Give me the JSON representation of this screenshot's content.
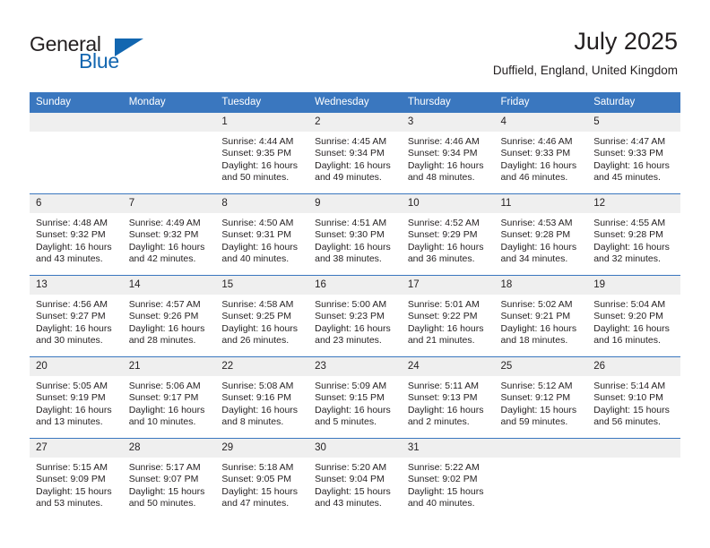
{
  "brand": {
    "name_part1": "General",
    "name_part2": "Blue",
    "flag_icon": "blue-triangle-flag"
  },
  "header": {
    "title": "July 2025",
    "location": "Duffield, England, United Kingdom"
  },
  "colors": {
    "header_blue": "#3a77bf",
    "daynum_bg": "#efefef",
    "brand_blue": "#1266b0",
    "text": "#231f20"
  },
  "weekday_headers": [
    "Sunday",
    "Monday",
    "Tuesday",
    "Wednesday",
    "Thursday",
    "Friday",
    "Saturday"
  ],
  "weeks": [
    [
      {
        "day": "",
        "empty": true,
        "sunrise": "",
        "sunset": "",
        "daylight1": "",
        "daylight2": ""
      },
      {
        "day": "",
        "empty": true,
        "sunrise": "",
        "sunset": "",
        "daylight1": "",
        "daylight2": ""
      },
      {
        "day": "1",
        "sunrise": "Sunrise: 4:44 AM",
        "sunset": "Sunset: 9:35 PM",
        "daylight1": "Daylight: 16 hours",
        "daylight2": "and 50 minutes."
      },
      {
        "day": "2",
        "sunrise": "Sunrise: 4:45 AM",
        "sunset": "Sunset: 9:34 PM",
        "daylight1": "Daylight: 16 hours",
        "daylight2": "and 49 minutes."
      },
      {
        "day": "3",
        "sunrise": "Sunrise: 4:46 AM",
        "sunset": "Sunset: 9:34 PM",
        "daylight1": "Daylight: 16 hours",
        "daylight2": "and 48 minutes."
      },
      {
        "day": "4",
        "sunrise": "Sunrise: 4:46 AM",
        "sunset": "Sunset: 9:33 PM",
        "daylight1": "Daylight: 16 hours",
        "daylight2": "and 46 minutes."
      },
      {
        "day": "5",
        "sunrise": "Sunrise: 4:47 AM",
        "sunset": "Sunset: 9:33 PM",
        "daylight1": "Daylight: 16 hours",
        "daylight2": "and 45 minutes."
      }
    ],
    [
      {
        "day": "6",
        "sunrise": "Sunrise: 4:48 AM",
        "sunset": "Sunset: 9:32 PM",
        "daylight1": "Daylight: 16 hours",
        "daylight2": "and 43 minutes."
      },
      {
        "day": "7",
        "sunrise": "Sunrise: 4:49 AM",
        "sunset": "Sunset: 9:32 PM",
        "daylight1": "Daylight: 16 hours",
        "daylight2": "and 42 minutes."
      },
      {
        "day": "8",
        "sunrise": "Sunrise: 4:50 AM",
        "sunset": "Sunset: 9:31 PM",
        "daylight1": "Daylight: 16 hours",
        "daylight2": "and 40 minutes."
      },
      {
        "day": "9",
        "sunrise": "Sunrise: 4:51 AM",
        "sunset": "Sunset: 9:30 PM",
        "daylight1": "Daylight: 16 hours",
        "daylight2": "and 38 minutes."
      },
      {
        "day": "10",
        "sunrise": "Sunrise: 4:52 AM",
        "sunset": "Sunset: 9:29 PM",
        "daylight1": "Daylight: 16 hours",
        "daylight2": "and 36 minutes."
      },
      {
        "day": "11",
        "sunrise": "Sunrise: 4:53 AM",
        "sunset": "Sunset: 9:28 PM",
        "daylight1": "Daylight: 16 hours",
        "daylight2": "and 34 minutes."
      },
      {
        "day": "12",
        "sunrise": "Sunrise: 4:55 AM",
        "sunset": "Sunset: 9:28 PM",
        "daylight1": "Daylight: 16 hours",
        "daylight2": "and 32 minutes."
      }
    ],
    [
      {
        "day": "13",
        "sunrise": "Sunrise: 4:56 AM",
        "sunset": "Sunset: 9:27 PM",
        "daylight1": "Daylight: 16 hours",
        "daylight2": "and 30 minutes."
      },
      {
        "day": "14",
        "sunrise": "Sunrise: 4:57 AM",
        "sunset": "Sunset: 9:26 PM",
        "daylight1": "Daylight: 16 hours",
        "daylight2": "and 28 minutes."
      },
      {
        "day": "15",
        "sunrise": "Sunrise: 4:58 AM",
        "sunset": "Sunset: 9:25 PM",
        "daylight1": "Daylight: 16 hours",
        "daylight2": "and 26 minutes."
      },
      {
        "day": "16",
        "sunrise": "Sunrise: 5:00 AM",
        "sunset": "Sunset: 9:23 PM",
        "daylight1": "Daylight: 16 hours",
        "daylight2": "and 23 minutes."
      },
      {
        "day": "17",
        "sunrise": "Sunrise: 5:01 AM",
        "sunset": "Sunset: 9:22 PM",
        "daylight1": "Daylight: 16 hours",
        "daylight2": "and 21 minutes."
      },
      {
        "day": "18",
        "sunrise": "Sunrise: 5:02 AM",
        "sunset": "Sunset: 9:21 PM",
        "daylight1": "Daylight: 16 hours",
        "daylight2": "and 18 minutes."
      },
      {
        "day": "19",
        "sunrise": "Sunrise: 5:04 AM",
        "sunset": "Sunset: 9:20 PM",
        "daylight1": "Daylight: 16 hours",
        "daylight2": "and 16 minutes."
      }
    ],
    [
      {
        "day": "20",
        "sunrise": "Sunrise: 5:05 AM",
        "sunset": "Sunset: 9:19 PM",
        "daylight1": "Daylight: 16 hours",
        "daylight2": "and 13 minutes."
      },
      {
        "day": "21",
        "sunrise": "Sunrise: 5:06 AM",
        "sunset": "Sunset: 9:17 PM",
        "daylight1": "Daylight: 16 hours",
        "daylight2": "and 10 minutes."
      },
      {
        "day": "22",
        "sunrise": "Sunrise: 5:08 AM",
        "sunset": "Sunset: 9:16 PM",
        "daylight1": "Daylight: 16 hours",
        "daylight2": "and 8 minutes."
      },
      {
        "day": "23",
        "sunrise": "Sunrise: 5:09 AM",
        "sunset": "Sunset: 9:15 PM",
        "daylight1": "Daylight: 16 hours",
        "daylight2": "and 5 minutes."
      },
      {
        "day": "24",
        "sunrise": "Sunrise: 5:11 AM",
        "sunset": "Sunset: 9:13 PM",
        "daylight1": "Daylight: 16 hours",
        "daylight2": "and 2 minutes."
      },
      {
        "day": "25",
        "sunrise": "Sunrise: 5:12 AM",
        "sunset": "Sunset: 9:12 PM",
        "daylight1": "Daylight: 15 hours",
        "daylight2": "and 59 minutes."
      },
      {
        "day": "26",
        "sunrise": "Sunrise: 5:14 AM",
        "sunset": "Sunset: 9:10 PM",
        "daylight1": "Daylight: 15 hours",
        "daylight2": "and 56 minutes."
      }
    ],
    [
      {
        "day": "27",
        "sunrise": "Sunrise: 5:15 AM",
        "sunset": "Sunset: 9:09 PM",
        "daylight1": "Daylight: 15 hours",
        "daylight2": "and 53 minutes."
      },
      {
        "day": "28",
        "sunrise": "Sunrise: 5:17 AM",
        "sunset": "Sunset: 9:07 PM",
        "daylight1": "Daylight: 15 hours",
        "daylight2": "and 50 minutes."
      },
      {
        "day": "29",
        "sunrise": "Sunrise: 5:18 AM",
        "sunset": "Sunset: 9:05 PM",
        "daylight1": "Daylight: 15 hours",
        "daylight2": "and 47 minutes."
      },
      {
        "day": "30",
        "sunrise": "Sunrise: 5:20 AM",
        "sunset": "Sunset: 9:04 PM",
        "daylight1": "Daylight: 15 hours",
        "daylight2": "and 43 minutes."
      },
      {
        "day": "31",
        "sunrise": "Sunrise: 5:22 AM",
        "sunset": "Sunset: 9:02 PM",
        "daylight1": "Daylight: 15 hours",
        "daylight2": "and 40 minutes."
      },
      {
        "day": "",
        "empty": true,
        "sunrise": "",
        "sunset": "",
        "daylight1": "",
        "daylight2": ""
      },
      {
        "day": "",
        "empty": true,
        "sunrise": "",
        "sunset": "",
        "daylight1": "",
        "daylight2": ""
      }
    ]
  ]
}
